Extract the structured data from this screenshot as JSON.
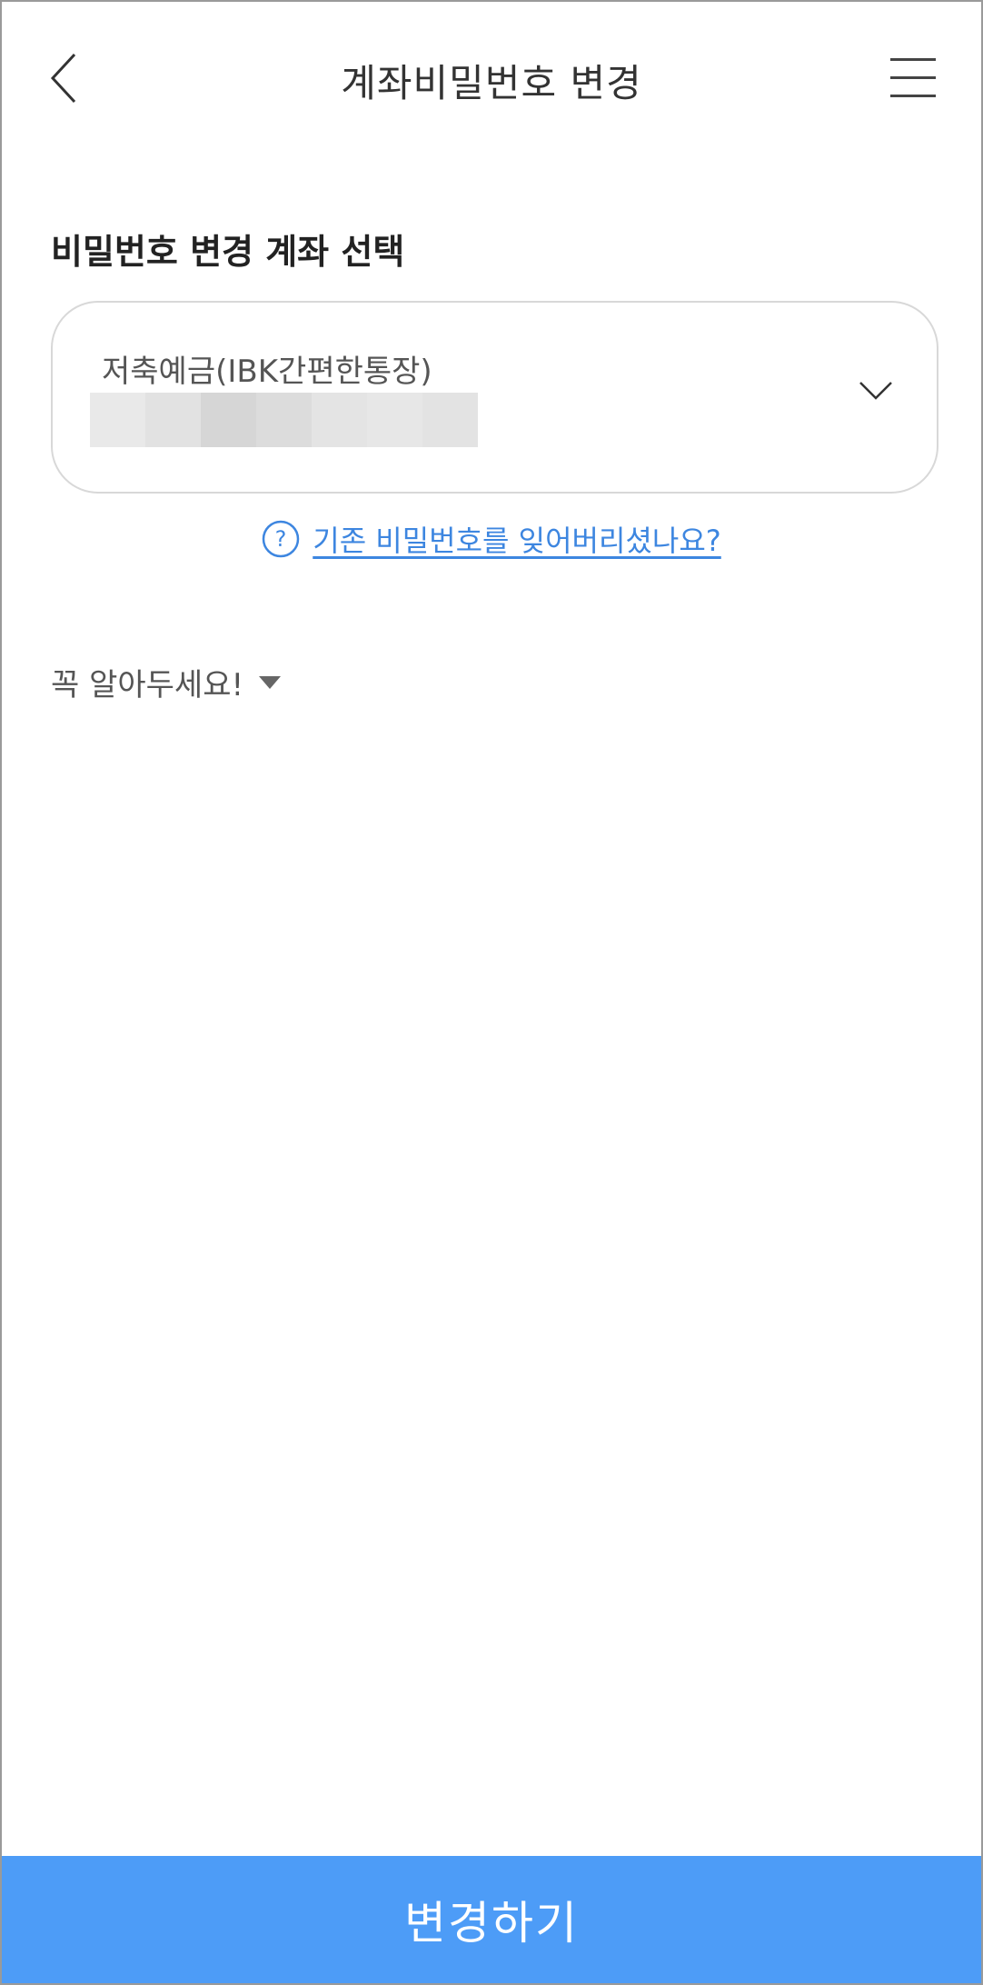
{
  "header": {
    "title": "계좌비밀번호 변경",
    "back_icon": "chevron-left-icon",
    "menu_icon": "hamburger-menu-icon"
  },
  "section": {
    "label": "비밀번호 변경 계좌 선택"
  },
  "account_select": {
    "account_name": "저축예금(IBK간편한통장)",
    "account_number_masked": true,
    "dropdown_icon": "chevron-down-icon"
  },
  "forgot_password": {
    "icon": "question-circle-icon",
    "link_text": "기존 비밀번호를 잊어버리셨나요?"
  },
  "notice": {
    "label": "꼭 알아두세요!",
    "toggle_icon": "caret-down-icon"
  },
  "submit": {
    "label": "변경하기"
  },
  "colors": {
    "primary_button": "#4d9cf7",
    "link": "#3d86e0",
    "border": "#d8d8d8"
  }
}
